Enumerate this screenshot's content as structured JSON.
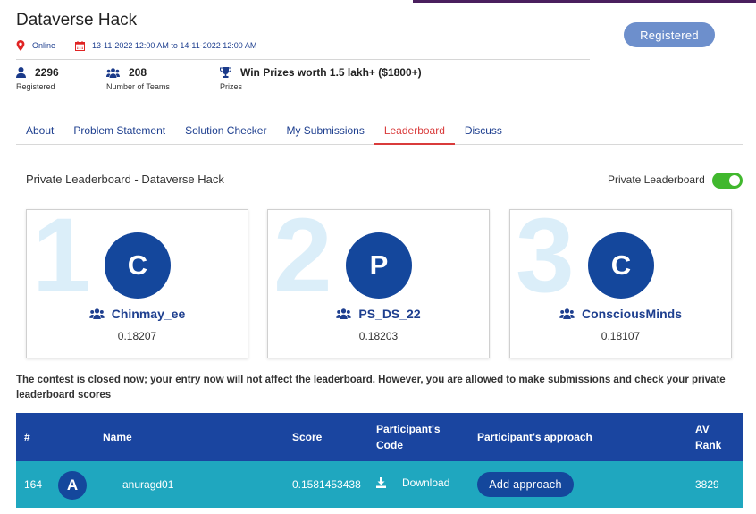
{
  "contest": {
    "title": "Dataverse Hack",
    "mode": "Online",
    "dates": "13-11-2022 12:00 AM to 14-11-2022 12:00 AM",
    "register_label": "Registered"
  },
  "stats": [
    {
      "value": "2296",
      "label": "Registered",
      "icon": "user-icon"
    },
    {
      "value": "208",
      "label": "Number of Teams",
      "icon": "users-icon"
    },
    {
      "value": "Win Prizes worth 1.5 lakh+ ($1800+)",
      "label": "Prizes",
      "icon": "trophy-icon"
    }
  ],
  "tabs": [
    {
      "label": "About",
      "active": false
    },
    {
      "label": "Problem Statement",
      "active": false
    },
    {
      "label": "Solution Checker",
      "active": false
    },
    {
      "label": "My Submissions",
      "active": false
    },
    {
      "label": "Leaderboard",
      "active": true
    },
    {
      "label": "Discuss",
      "active": false
    }
  ],
  "leaderboard": {
    "title": "Private Leaderboard - Dataverse Hack",
    "toggle_label": "Private Leaderboard",
    "toggle_on": true,
    "podium": [
      {
        "rank": "1",
        "initial": "C",
        "team": "Chinmay_ee",
        "score": "0.18207"
      },
      {
        "rank": "2",
        "initial": "P",
        "team": "PS_DS_22",
        "score": "0.18203"
      },
      {
        "rank": "3",
        "initial": "C",
        "team": "ConsciousMinds",
        "score": "0.18107"
      }
    ],
    "notice": "The contest is closed now; your entry now will not affect the leaderboard. However, you are allowed to make submissions and check your private leaderboard scores"
  },
  "table": {
    "headers": {
      "rank": "#",
      "name": "Name",
      "score": "Score",
      "code_line1": "Participant's",
      "code_line2": "Code",
      "approach": "Participant's approach",
      "av_line1": "AV",
      "av_line2": "Rank"
    },
    "row": {
      "rank": "164",
      "initial": "A",
      "name": "anuragd01",
      "score": "0.1581453438",
      "download_label": "Download",
      "approach_button": "Add approach",
      "av_rank": "3829"
    }
  },
  "colors": {
    "primary": "#14479c",
    "header_bg": "#1a45a0",
    "row_bg": "#1fa7bf",
    "active_tab": "#d93b3b",
    "toggle_on": "#41b82e",
    "register_button": "#6d8fcc",
    "rank_watermark": "#dbeef9"
  }
}
